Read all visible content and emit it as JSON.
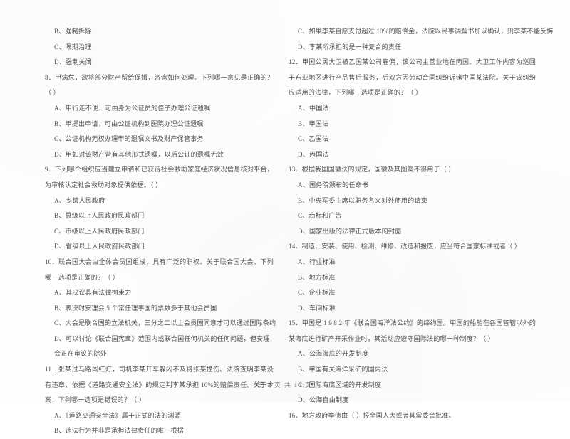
{
  "document": {
    "type": "scanned-exam-paper",
    "language": "zh-CN",
    "footer": "第 2 页  共 15 页"
  },
  "left_column": {
    "orphan_options": [
      "B、强制拆除",
      "C、限期治理",
      "D、强制关闭"
    ],
    "questions": [
      {
        "number": "8",
        "stem": "8．甲病危，欲将部分财产留给保姆，咨询如何处理。下列哪一意见是正确的？（    ）",
        "options": [
          "A、甲行走不便，可由身为公证员的侄子办理公证遗嘱",
          "B、甲提出申请，可由公证机构到医院办理公证遗嘱",
          "C、公证机构无权办理甲的遗嘱文书及财产保管事务",
          "D、甲如对该财产曾有其他形式遗嘱，以后公证的遗嘱无效"
        ]
      },
      {
        "number": "9",
        "stem": "9．下列哪个组织应当建立申请和已获得社会救助家庭经济状况信息核对平台，为审核认定社会救助对象提供依据。（    ）",
        "options": [
          "A、乡镇人民政府",
          "B、县级以上人民政府民政部门",
          "C、市级以上人民政府民政部门",
          "D、省级以上人民政府民政部门"
        ]
      },
      {
        "number": "10",
        "stem": "10．联合国大会由全体会员国组成，具有广泛的职权。关于联合国大会，下列哪一选项是正确的？（    ）",
        "options": [
          "A、其决议具有法律拘束力",
          "B、表决时安理会 5 个常任理事国的票数多于其他会员国",
          "C、大会是联合国的立法机关，三分之二以上会员国同意才可以通过国际条约",
          "D、可以讨论《联合国宪章》范围内或联合国任何机关的任何问题，但安理会正在审议的除外"
        ]
      },
      {
        "number": "11",
        "stem": "11．张某过马路闯红灯，司机李某开车躲闪不及将张某撞伤。法院查明李某没有违章，依据《道路交通安全法》的规定判李某承担 10%的赔偿责任。关于本案，下列哪一选项是错误的？（    ）",
        "options": [
          "A、《道路交通安全法》属于正式的法的渊源",
          "B、违法行为并非是承担法律责任的唯一根据"
        ]
      }
    ]
  },
  "right_column": {
    "continued_options": [
      "C、如果李某自愿支付超过 10%的赔偿金，法院以民事调解书加以确认，则李某不能反悔",
      "D、李某所承担的是一种复合的责任"
    ],
    "questions": [
      {
        "number": "12",
        "stem": "12．甲国公民大卫被乙国某公司雇佣，该公司主营业地在丙国。大卫工作内容为巡回于东亚地区进行产品售后服务，后双方因劳动合同纠纷诉诸中国某法院。关于该纠纷应适用的法律，下列哪一选项是正确的？（    ）",
        "options": [
          "A、中国法",
          "B、甲国法",
          "C、乙国法",
          "D、丙国法"
        ]
      },
      {
        "number": "13",
        "stem": "13．根据我国国徽法的规定，国徽及其图案不得用于（    ）",
        "options": [
          "A、国务院颁布的任命书",
          "B、中央军委主席以职务名义对外使用的请柬",
          "C、商标和广告",
          "D、国家出版的法律正式版本的封面"
        ]
      },
      {
        "number": "14",
        "stem": "14．制造、安装、使用、检测、维修、改造和报废，应当符合国家标准或者（    ）",
        "options": [
          "A、行业标准",
          "B、地方标准",
          "C、企业标准",
          "D、车间标准"
        ]
      },
      {
        "number": "15",
        "stem": "15．甲国是 1 9 8 2 年《联合国海洋法公约》的缔约国。甲国的船舶在各国管辖以外的某海底进行矿产开采作业时，其活动应遵守国际法的哪一种制度？（    ）",
        "options": [
          "A、公海海底的开发制度",
          "B、甲国有关海洋采矿的国内法",
          "C、国际海底区域的开发制度",
          "D、公海自由制度"
        ]
      },
      {
        "number": "16",
        "stem": "16．地方政府举债由（    ）报全国人大或者其常委会批准。",
        "options": []
      }
    ]
  }
}
